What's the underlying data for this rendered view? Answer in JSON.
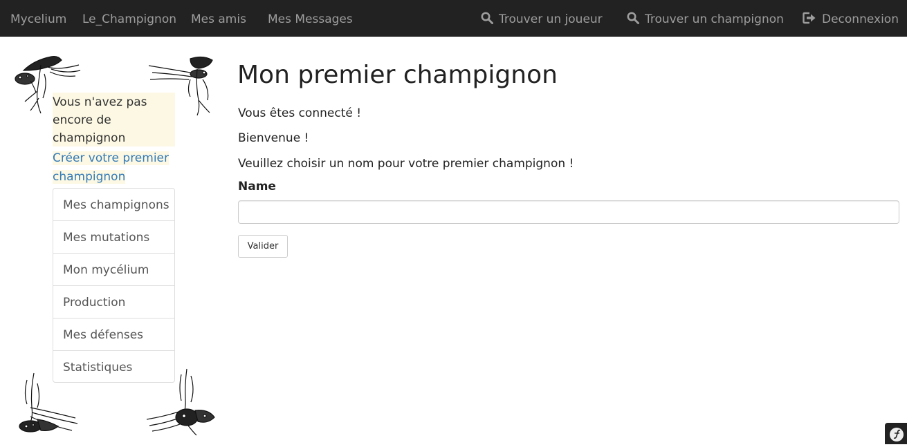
{
  "navbar": {
    "left_links": [
      "Mycelium",
      "Le_Champignon",
      "Mes amis",
      "Mes Messages"
    ],
    "find_player": "Trouver un joueur",
    "find_mushroom": "Trouver un champignon",
    "logout": "Deconnexion",
    "icons": [
      "search-icon",
      "search-icon",
      "logout-icon"
    ],
    "background": "#222222",
    "link_color": "#9d9d9d"
  },
  "sidebar": {
    "info_text": "Vous n'avez pas encore de champignon",
    "create_link": "Créer votre premier champignon",
    "menu": [
      "Mes champignons",
      "Mes mutations",
      "Mon mycélium",
      "Production",
      "Mes défenses",
      "Statistiques"
    ]
  },
  "main": {
    "title": "Mon premier champignon",
    "connected": "Vous êtes connecté !",
    "welcome": "Bienvenue !",
    "instruction": "Veuillez choisir un nom pour votre premier champignon !",
    "name_label": "Name",
    "name_value": "",
    "submit": "Valider"
  },
  "colors": {
    "link": "#337ab7",
    "highlight": "#fcf8e3"
  }
}
